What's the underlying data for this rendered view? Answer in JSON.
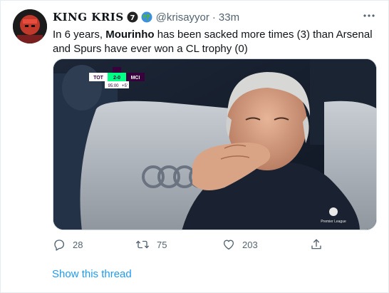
{
  "tweet": {
    "display_name": "KING KRIS",
    "handle": "@krisayyor",
    "separator": "·",
    "time": "33m",
    "text_before": "In 6 years, ",
    "text_bold": "Mourinho",
    "text_after": " has been sacked more times (3) than Arsenal and Spurs have ever won a CL trophy (0)",
    "media": {
      "score_home": "TOT",
      "score": "2-0",
      "score_away": "MCI",
      "clock": "95:00",
      "added_time": "+5'",
      "league_logo_text": "Premier League"
    },
    "actions": {
      "replies": "28",
      "retweets": "75",
      "likes": "203"
    },
    "show_thread": "Show this thread"
  },
  "icons": {
    "badge_number": "7",
    "badge_icon": "number-7-icon",
    "globe_icon": "globe-emoji-icon",
    "more_icon": "more-icon",
    "reply_icon": "reply-icon",
    "retweet_icon": "retweet-icon",
    "like_icon": "heart-icon",
    "share_icon": "share-icon"
  },
  "colors": {
    "accent": "#1d9bf0",
    "secondary_text": "#536471",
    "score_green": "#00ff85",
    "score_purple": "#38003c"
  }
}
